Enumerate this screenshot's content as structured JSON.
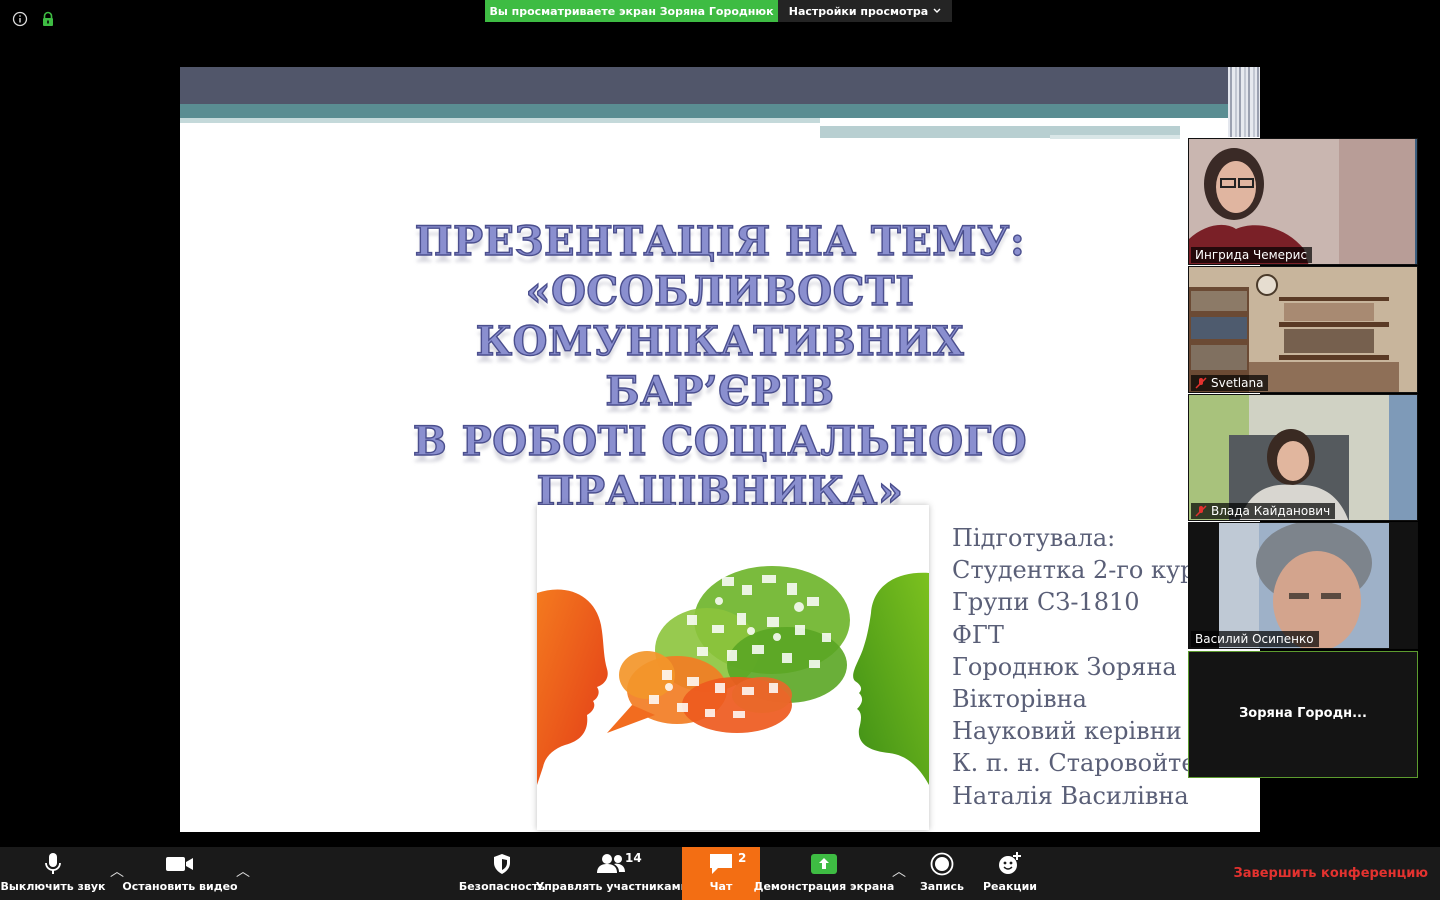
{
  "top_bar": {
    "share_banner": "Вы просматриваете экран Зоряна Городнюк",
    "view_settings": "Настройки просмотра",
    "icons": [
      "info-icon",
      "lock-icon"
    ]
  },
  "slide": {
    "title_lines": [
      "ПРЕЗЕНТАЦІЯ НА ТЕМУ:",
      "«ОСОБЛИВОСТІ",
      "КОМУНІКАТИВНИХ БАР’ЄРІВ",
      "В РОБОТІ СОЦІАЛЬНОГО",
      "ПРАЦІВНИКА»"
    ],
    "info_lines": [
      "Підготувала:",
      "Студентка 2-го кур",
      "Групи СЗ-1810",
      "ФГТ",
      "Городнюк Зоряна",
      "Вікторівна",
      "Науковий керівни",
      "К. п. н. Старовойте",
      "Наталія Василівна"
    ],
    "colors": {
      "title": "#8a8fcf",
      "title_outline": "#4b4f8e",
      "head_left": "#f05a1c",
      "head_right": "#55a51b"
    }
  },
  "participants": [
    {
      "name": "Ингрида Чемерис",
      "muted": false
    },
    {
      "name": "Svetlana",
      "muted": true
    },
    {
      "name": "Влада Кайданович",
      "muted": true
    },
    {
      "name": "Василий Осипенко",
      "muted": false
    },
    {
      "name": "Зоряна  Городн...",
      "active": true
    }
  ],
  "toolbar": {
    "mute": "Выключить звук",
    "stop_video": "Остановить видео",
    "security": "Безопасность",
    "participants": "Управлять участниками",
    "participants_count": "14",
    "chat": "Чат",
    "chat_count": "2",
    "share": "Демонстрация экрана",
    "record": "Запись",
    "reactions": "Реакции",
    "end": "Завершить конференцию",
    "accent_chat": "#f36e13",
    "accent_share": "#3ebc43",
    "accent_end": "#e3322f"
  }
}
